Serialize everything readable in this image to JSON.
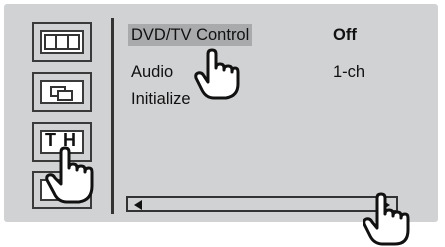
{
  "menu": {
    "items": [
      {
        "label": "DVD/TV Control",
        "value": "Off",
        "selected": true,
        "value_bold": true
      },
      {
        "label": "Audio",
        "value": "1-ch",
        "selected": false,
        "value_bold": false
      },
      {
        "label": "Initialize",
        "value": "",
        "selected": false,
        "value_bold": false
      }
    ]
  },
  "side_icons": [
    {
      "name": "screen-mode-icon"
    },
    {
      "name": "picture-in-picture-icon"
    },
    {
      "name": "tv-th-icon",
      "text": "T H"
    },
    {
      "name": "page-icon"
    }
  ],
  "colors": {
    "screen_bg": "#d1d2d4",
    "selected_bg": "#a9aaac",
    "outline": "#333333"
  }
}
